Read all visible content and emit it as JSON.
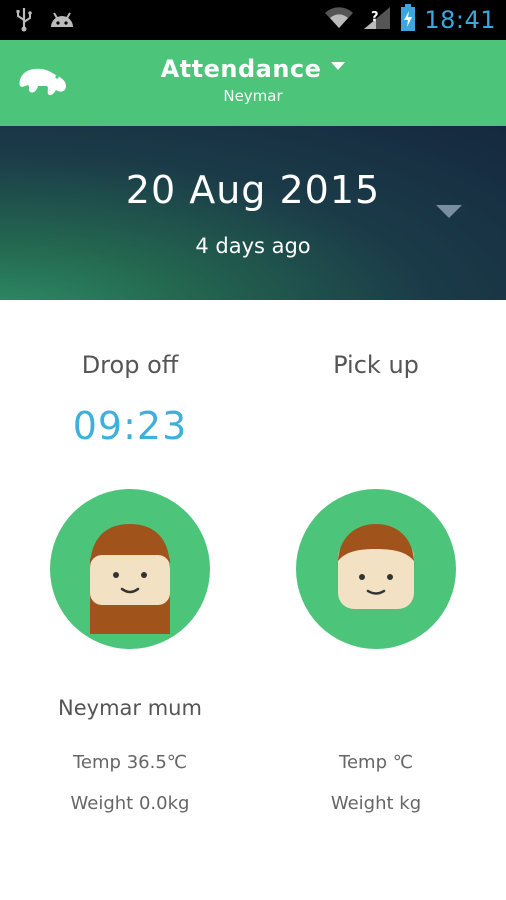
{
  "status_bar": {
    "time": "18:41",
    "icons": [
      "usb-icon",
      "android-icon",
      "wifi-icon",
      "signal-icon",
      "battery-charging-icon"
    ]
  },
  "app_bar": {
    "title": "Attendance",
    "subtitle": "Neymar",
    "logo_icon": "bear-logo-icon"
  },
  "date_header": {
    "date": "20 Aug 2015",
    "relative": "4 days ago"
  },
  "drop_off": {
    "label": "Drop off",
    "time": "09:23",
    "person": "Neymar mum",
    "temp": "Temp 36.5℃",
    "weight": "Weight 0.0kg"
  },
  "pick_up": {
    "label": "Pick up",
    "time": "",
    "person": "",
    "temp": "Temp ℃",
    "weight": "Weight kg"
  },
  "colors": {
    "accent_green": "#4cc47a",
    "time_blue": "#3db0dd",
    "hair": "#a0541c",
    "skin": "#f3e1c4"
  }
}
